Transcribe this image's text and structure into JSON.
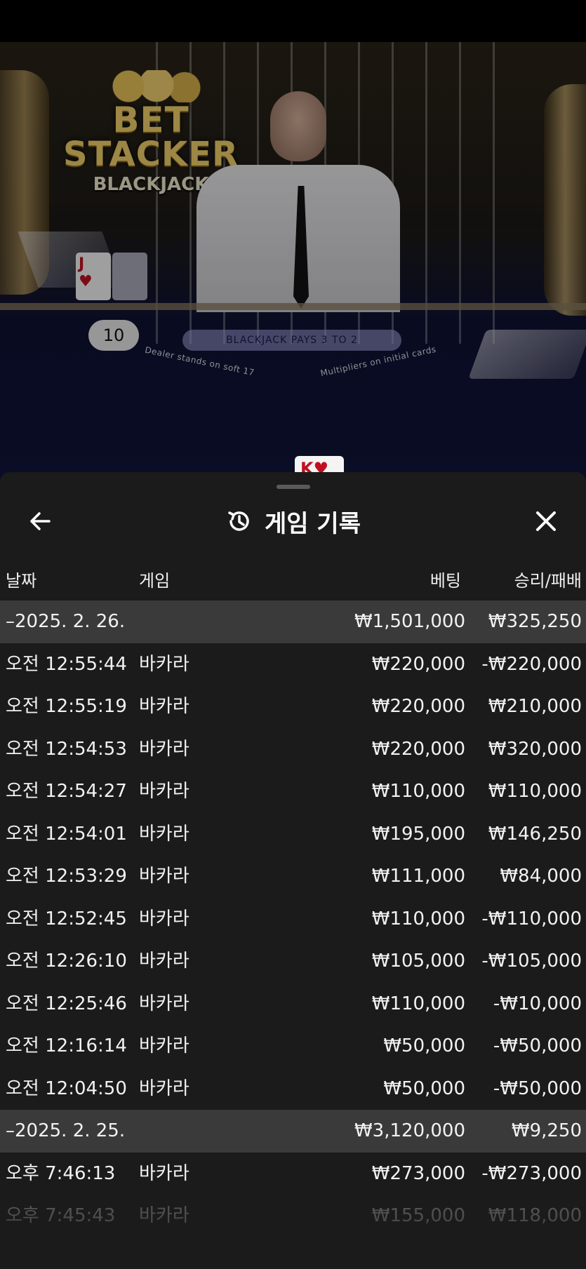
{
  "video": {
    "logo_line1": "BET",
    "logo_line2": "STACKER",
    "logo_line3": "BLACKJACK",
    "count_badge": "10",
    "pays_banner": "BLACKJACK PAYS 3 TO 2",
    "table_left_text": "Dealer stands on soft 17",
    "table_right_text": "Multipliers on initial cards",
    "card_left_rank": "J",
    "card_left_suit": "♥",
    "card_bottom_rank": "K",
    "card_bottom_suit": "♥"
  },
  "header": {
    "title": "게임 기록",
    "back_icon": "arrow-left-icon",
    "history_icon": "history-icon",
    "close_icon": "close-icon"
  },
  "columns": {
    "date": "날짜",
    "game": "게임",
    "bet": "베팅",
    "result": "승리/패배"
  },
  "rows": [
    {
      "type": "group",
      "date": "–2025. 2. 26.",
      "game": "",
      "bet": "₩1,501,000",
      "result": "₩325,250"
    },
    {
      "type": "item",
      "date": "오전 12:55:44",
      "game": "바카라",
      "bet": "₩220,000",
      "result": "-₩220,000"
    },
    {
      "type": "item",
      "date": "오전 12:55:19",
      "game": "바카라",
      "bet": "₩220,000",
      "result": "₩210,000"
    },
    {
      "type": "item",
      "date": "오전 12:54:53",
      "game": "바카라",
      "bet": "₩220,000",
      "result": "₩320,000"
    },
    {
      "type": "item",
      "date": "오전 12:54:27",
      "game": "바카라",
      "bet": "₩110,000",
      "result": "₩110,000"
    },
    {
      "type": "item",
      "date": "오전 12:54:01",
      "game": "바카라",
      "bet": "₩195,000",
      "result": "₩146,250"
    },
    {
      "type": "item",
      "date": "오전 12:53:29",
      "game": "바카라",
      "bet": "₩111,000",
      "result": "₩84,000"
    },
    {
      "type": "item",
      "date": "오전 12:52:45",
      "game": "바카라",
      "bet": "₩110,000",
      "result": "-₩110,000"
    },
    {
      "type": "item",
      "date": "오전 12:26:10",
      "game": "바카라",
      "bet": "₩105,000",
      "result": "-₩105,000"
    },
    {
      "type": "item",
      "date": "오전 12:25:46",
      "game": "바카라",
      "bet": "₩110,000",
      "result": "-₩10,000"
    },
    {
      "type": "item",
      "date": "오전 12:16:14",
      "game": "바카라",
      "bet": "₩50,000",
      "result": "-₩50,000"
    },
    {
      "type": "item",
      "date": "오전 12:04:50",
      "game": "바카라",
      "bet": "₩50,000",
      "result": "-₩50,000"
    },
    {
      "type": "group",
      "date": "–2025. 2. 25.",
      "game": "",
      "bet": "₩3,120,000",
      "result": "₩9,250"
    },
    {
      "type": "item",
      "date": "오후 7:46:13",
      "game": "바카라",
      "bet": "₩273,000",
      "result": "-₩273,000"
    },
    {
      "type": "item",
      "date": "오후 7:45:43",
      "game": "바카라",
      "bet": "₩155,000",
      "result": "₩118,000",
      "faded": true
    }
  ],
  "colors": {
    "sheet_bg": "#1b1b1b",
    "group_row_bg": "#3a3a3a",
    "text": "#f2f2f2"
  }
}
